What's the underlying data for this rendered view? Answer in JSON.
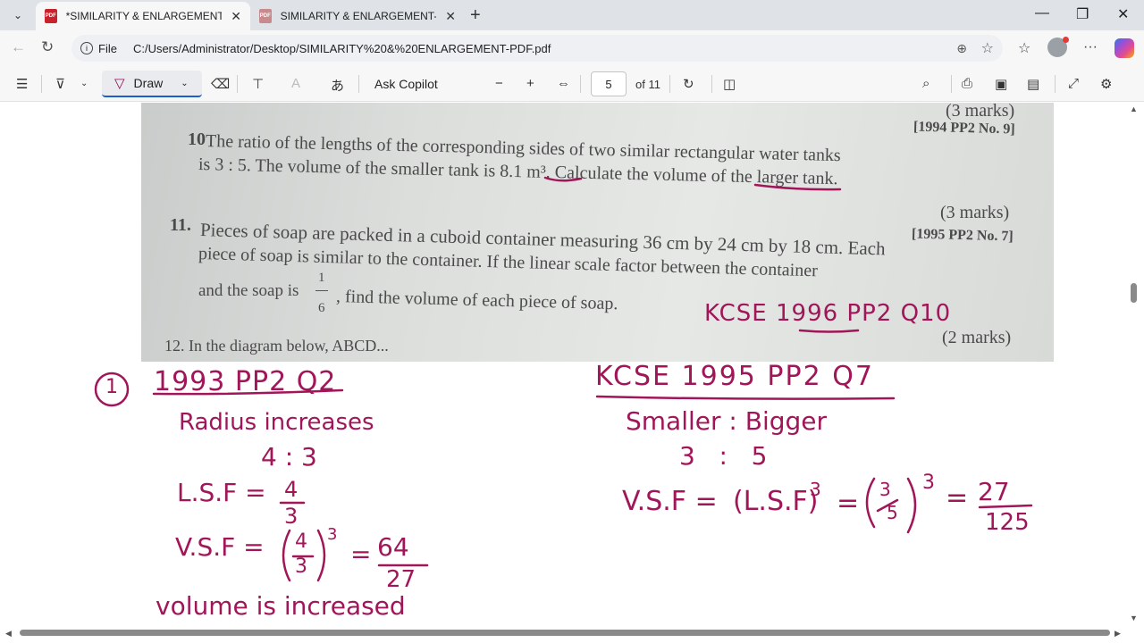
{
  "browser": {
    "tabs": [
      {
        "title": "*SIMILARITY & ENLARGEMENT-PDF.pdf",
        "active": true
      },
      {
        "title": "SIMILARITY & ENLARGEMENT-PDF.pdf",
        "active": false
      }
    ],
    "address": {
      "scheme_label": "File",
      "url": "C:/Users/Administrator/Desktop/SIMILARITY%20&%20ENLARGEMENT-PDF.pdf"
    }
  },
  "pdf_toolbar": {
    "draw_label": "Draw",
    "ask_label": "Ask Copilot",
    "page_current": "5",
    "page_total": "of 11"
  },
  "document": {
    "q_prev_marks": "(3 marks)",
    "q10": {
      "number": "10",
      "source": "[1994 PP2 No. 9]",
      "line1": "The ratio of the lengths of the corresponding sides of two similar rectangular water tanks",
      "line2": "is 3 : 5.  The volume of the smaller tank is 8.1 m³.  Calculate the volume of the larger tank.",
      "marks": "(3 marks)"
    },
    "q11": {
      "number": "11.",
      "source": "[1995 PP2 No. 7]",
      "line1": "Pieces of soap are packed in a cuboid container measuring 36 cm by 24 cm by 18 cm. Each",
      "line2": "piece of soap is similar to the container.  If the linear scale factor between the container",
      "line3_a": "and the soap is",
      "frac_num": "1",
      "frac_den": "6",
      "line3_b": ", find the volume of each piece of soap.",
      "marks": "(2 marks)"
    },
    "q12_partial": "12. In the diagram below, ABCD..."
  },
  "handwriting": {
    "photo_note": "KCSE 1996 PP2 Q10",
    "left": {
      "heading": "1993 PP2 Q2",
      "circle_num": "1",
      "line1": "Radius increases",
      "line2": "4 : 3",
      "lsf_label": "L.S.F =",
      "lsf_num": "4",
      "lsf_den": "3",
      "vsf_label": "V.S.F =",
      "vsf_exp": "3",
      "vsf_eq": "=",
      "vsf_num": "64",
      "vsf_den": "27",
      "conclusion": "volume is increased"
    },
    "right": {
      "heading": "KCSE 1995 PP2 Q7",
      "line1": "Smaller : Bigger",
      "line2": "3   :   5",
      "vsf_label": "V.S.F =",
      "lsf_paren": "(L.S.F)",
      "exp": "3",
      "eq": "=",
      "result_num": "27",
      "result_den": "125"
    }
  },
  "colors": {
    "ink": "#a01659",
    "accent": "#1a5fd0"
  }
}
